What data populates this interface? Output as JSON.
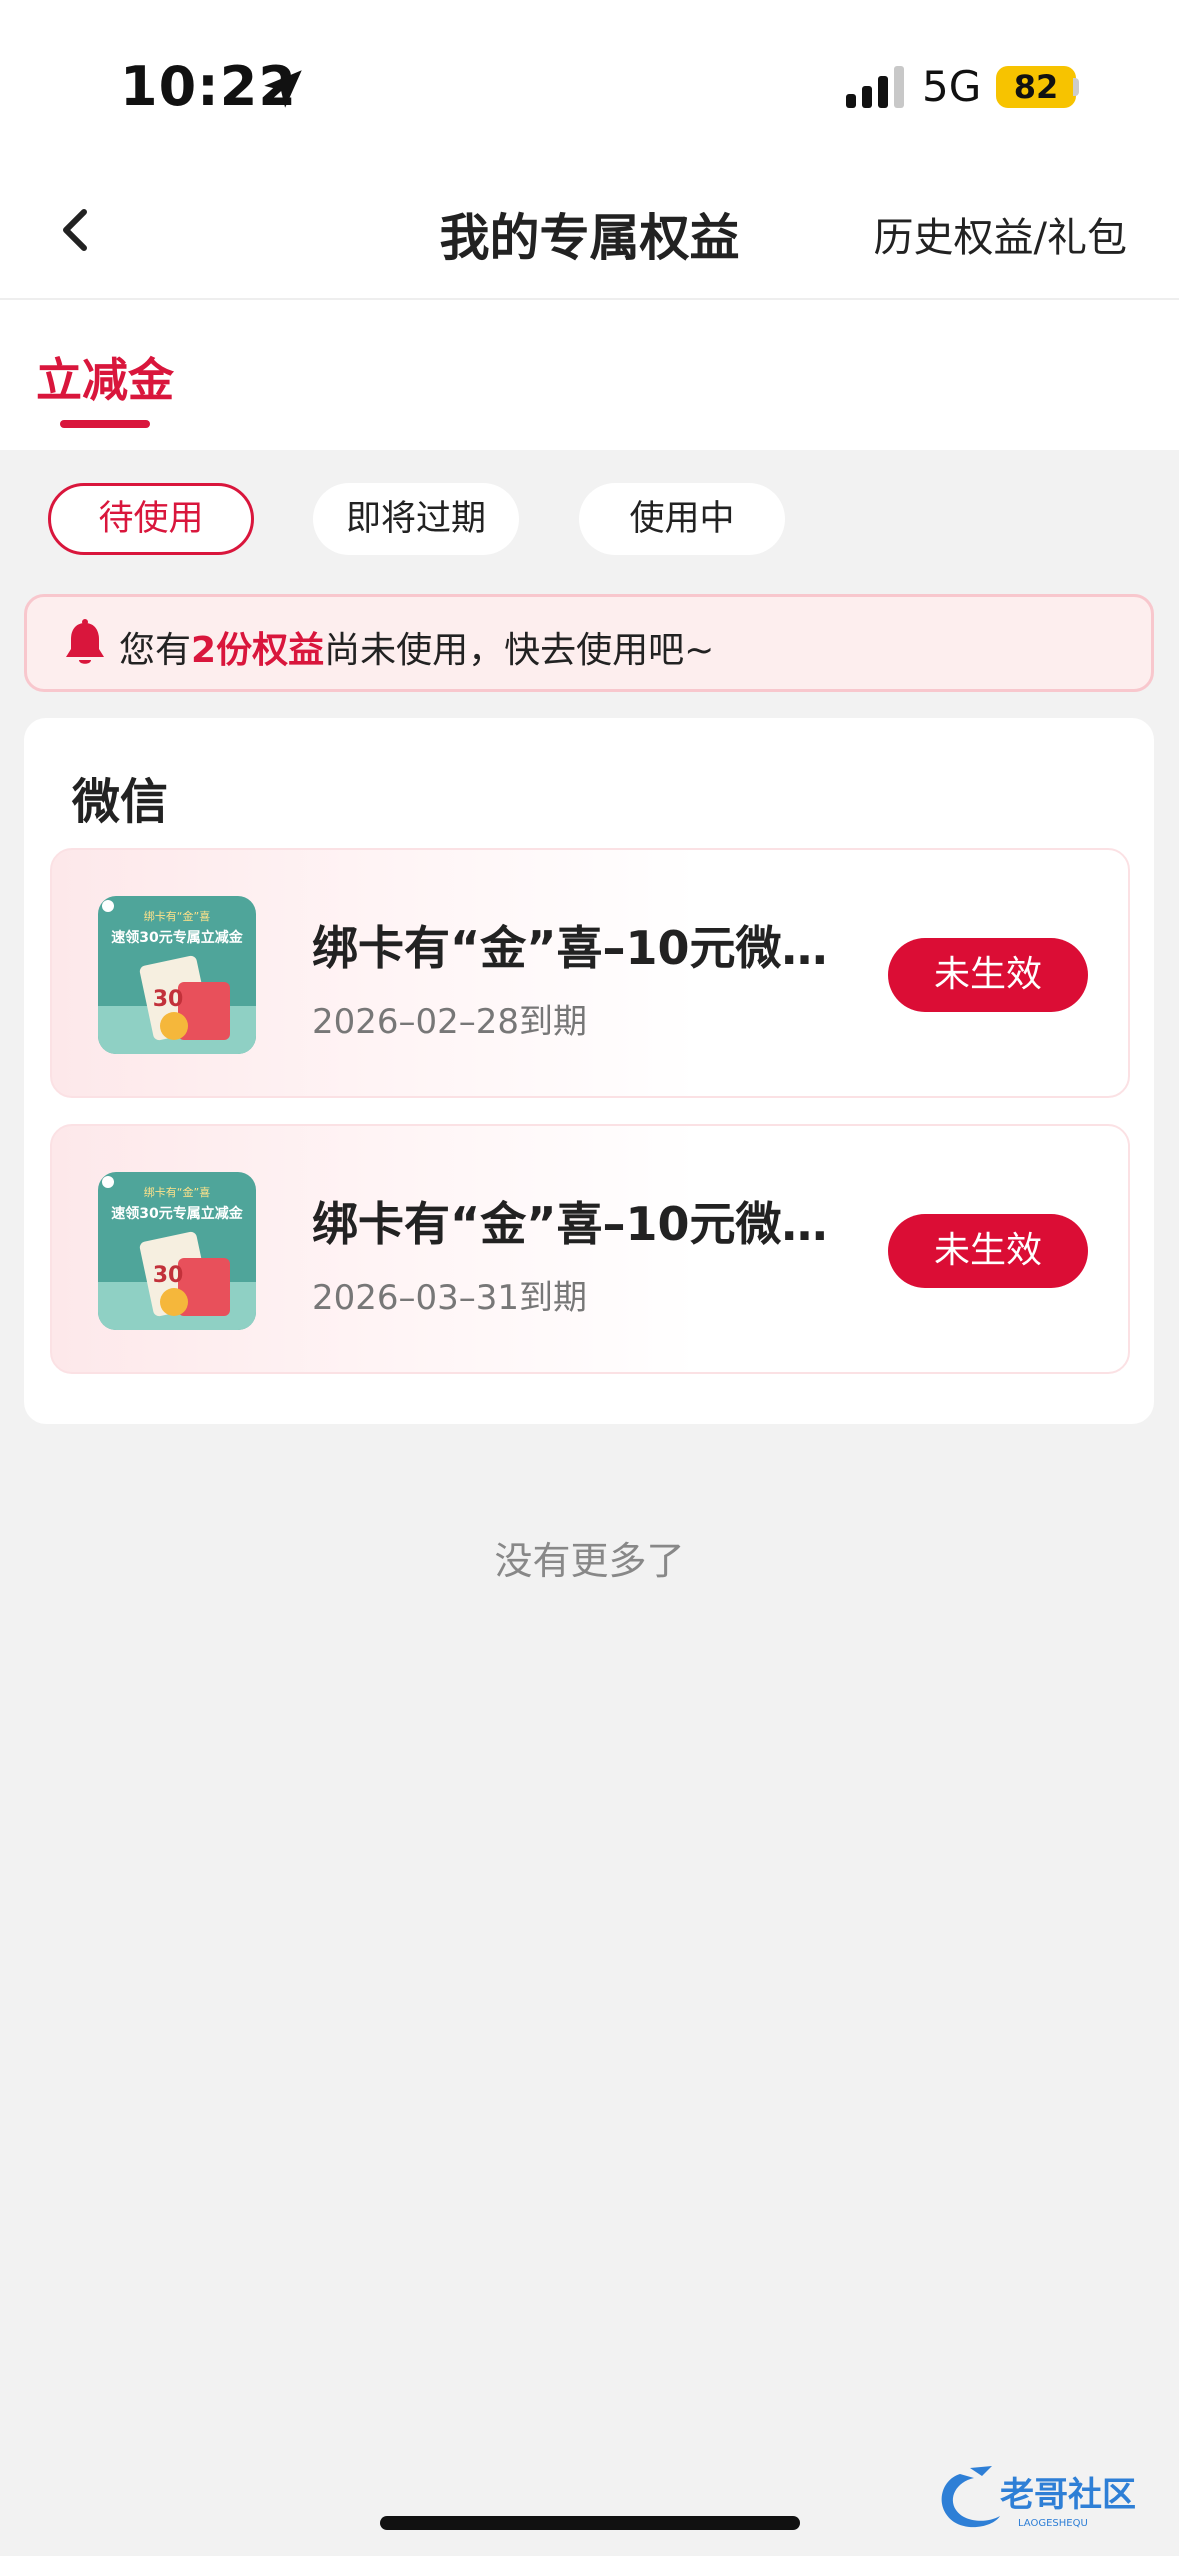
{
  "status_bar": {
    "time": "10:22",
    "network": "5G",
    "battery": "82"
  },
  "nav": {
    "title": "我的专属权益",
    "history_link": "历史权益/礼包"
  },
  "tabs": [
    {
      "label": "立减金",
      "active": true
    }
  ],
  "filters": [
    {
      "label": "待使用",
      "active": true
    },
    {
      "label": "即将过期",
      "active": false
    },
    {
      "label": "使用中",
      "active": false
    }
  ],
  "notice": {
    "prefix": "您有",
    "highlight": "2份权益",
    "suffix": "尚未使用，快去使用吧~"
  },
  "section": {
    "title": "微信",
    "coupons": [
      {
        "name": "绑卡有“金”喜–10元微…",
        "expiry": "2026–02–28到期",
        "status": "未生效",
        "thumb": {
          "headline": "绑卡有“金”喜",
          "line": "速领30元专属立减金",
          "amount": "30"
        }
      },
      {
        "name": "绑卡有“金”喜–10元微…",
        "expiry": "2026–03–31到期",
        "status": "未生效",
        "thumb": {
          "headline": "绑卡有“金”喜",
          "line": "速领30元专属立减金",
          "amount": "30"
        }
      }
    ]
  },
  "footer": {
    "no_more": "没有更多了"
  },
  "watermark": {
    "text": "老哥社区",
    "sub": "LAOGESHEQU"
  },
  "colors": {
    "accent": "#d9163c",
    "button": "#db0d35",
    "notice_bg": "#fdeeee",
    "page_bg": "#f2f2f2"
  }
}
